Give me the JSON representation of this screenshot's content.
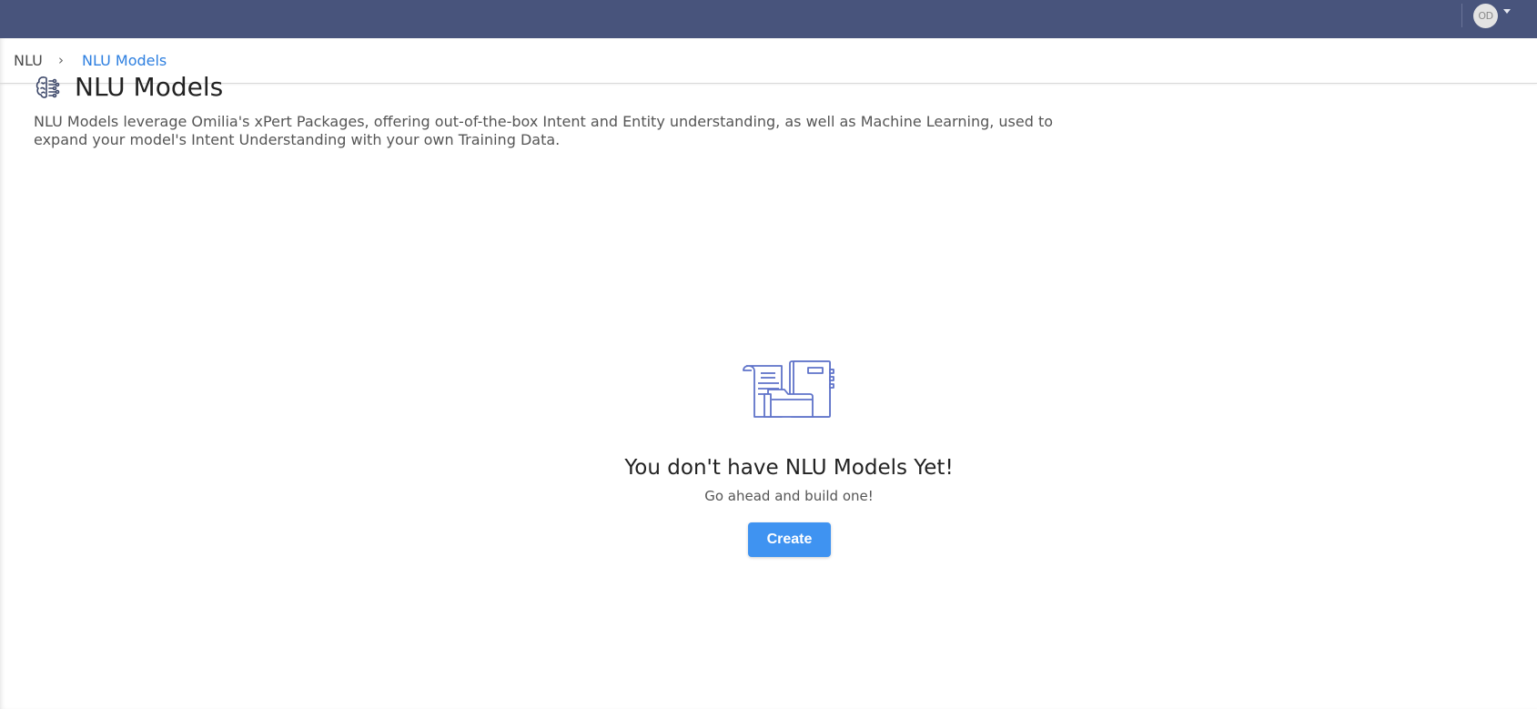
{
  "header": {
    "avatar_initials": "OD",
    "avatar_caret_icon": "caret-down-icon"
  },
  "breadcrumb": {
    "root": "NLU",
    "separator_icon": "chevron-right-icon",
    "separator": "›",
    "current": "NLU Models"
  },
  "page": {
    "icon": "brain-circuit-icon",
    "title": "NLU Models",
    "description": "NLU Models leverage Omilia's xPert Packages, offering out-of-the-box Intent and Entity understanding, as well as Machine Learning, used to expand your model's Intent Understanding with your own Training Data."
  },
  "empty_state": {
    "illustration": "documents-folder-illustration",
    "title": "You don't have NLU Models Yet!",
    "subtitle": "Go ahead and build one!",
    "create_label": "Create"
  },
  "colors": {
    "topbar": "#48547c",
    "accent": "#2d7fe0",
    "button": "#3f93f1",
    "illustration": "#5f73c9"
  }
}
